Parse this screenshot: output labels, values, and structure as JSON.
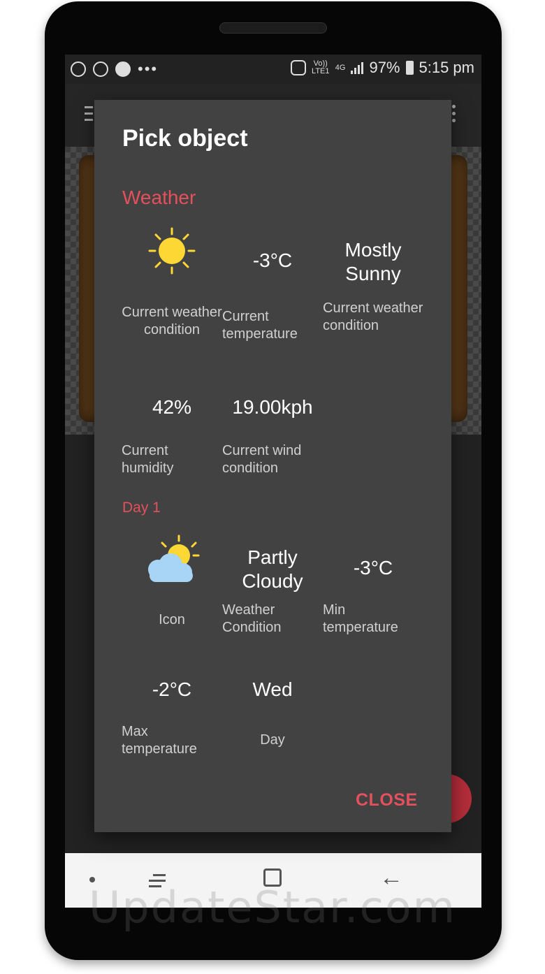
{
  "status_bar": {
    "network_label": "Vo)) LTE1",
    "network_type": "4G",
    "battery": "97%",
    "time": "5:15 pm"
  },
  "dialog": {
    "title": "Pick object",
    "close_label": "CLOSE",
    "sections": [
      {
        "header": "Weather",
        "items": [
          {
            "value": "",
            "icon": "sun-icon",
            "label": "Current weather condition"
          },
          {
            "value": "-3°C",
            "label": "Current temperature"
          },
          {
            "value": "Mostly Sunny",
            "label": "Current weather condition"
          },
          {
            "value": "42%",
            "label": "Current humidity"
          },
          {
            "value": "19.00kph",
            "label": "Current wind condition"
          }
        ]
      },
      {
        "header": "Day 1",
        "items": [
          {
            "value": "",
            "icon": "partly-cloudy-icon",
            "label": "Icon"
          },
          {
            "value": "Partly Cloudy",
            "label": "Weather Condition"
          },
          {
            "value": "-3°C",
            "label": "Min temperature"
          },
          {
            "value": "-2°C",
            "label": "Max temperature"
          },
          {
            "value": "Wed",
            "label": "Day"
          }
        ]
      }
    ]
  },
  "watermark": "UpdateStar.com",
  "colors": {
    "accent": "#e4505c",
    "dialog_bg": "#424242",
    "sun": "#fdd835",
    "cloud": "#a8d4f5"
  }
}
